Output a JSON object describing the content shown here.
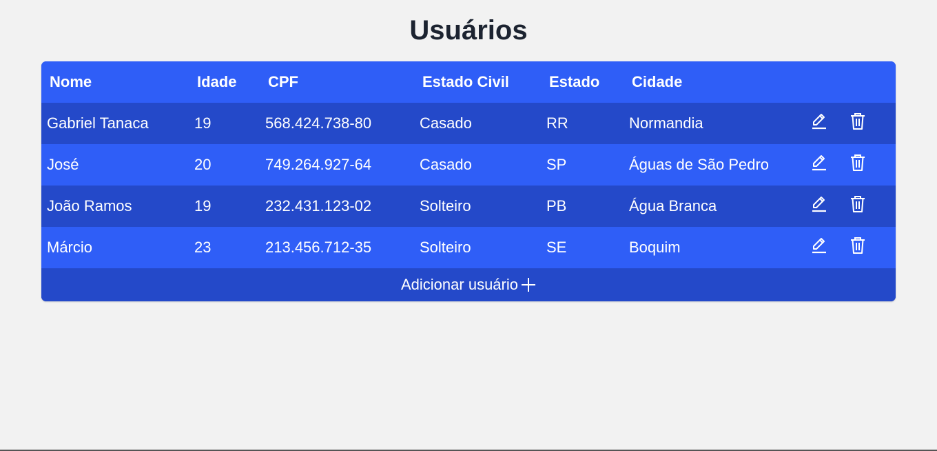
{
  "page": {
    "title": "Usuários"
  },
  "table": {
    "headers": {
      "nome": "Nome",
      "idade": "Idade",
      "cpf": "CPF",
      "estado_civil": "Estado Civil",
      "estado": "Estado",
      "cidade": "Cidade"
    },
    "rows": [
      {
        "nome": "Gabriel Tanaca",
        "idade": "19",
        "cpf": "568.424.738-80",
        "estado_civil": "Casado",
        "estado": "RR",
        "cidade": "Normandia"
      },
      {
        "nome": "José",
        "idade": "20",
        "cpf": "749.264.927-64",
        "estado_civil": "Casado",
        "estado": "SP",
        "cidade": "Águas de São Pedro"
      },
      {
        "nome": "João Ramos",
        "idade": "19",
        "cpf": "232.431.123-02",
        "estado_civil": "Solteiro",
        "estado": "PB",
        "cidade": "Água Branca"
      },
      {
        "nome": "Márcio",
        "idade": "23",
        "cpf": "213.456.712-35",
        "estado_civil": "Solteiro",
        "estado": "SE",
        "cidade": "Boquim"
      }
    ],
    "row_actions": {
      "edit_icon": "pencil-icon",
      "delete_icon": "trash-icon"
    },
    "footer": {
      "add_label": "Adicionar usuário",
      "add_icon": "plus-icon"
    }
  },
  "colors": {
    "background": "#f2f2f2",
    "header_blue": "#2f5ef7",
    "row_dark_blue": "#2449c9",
    "row_light_blue": "#2f5ef7",
    "title_text": "#1c2330",
    "cell_text": "#ffffff"
  }
}
